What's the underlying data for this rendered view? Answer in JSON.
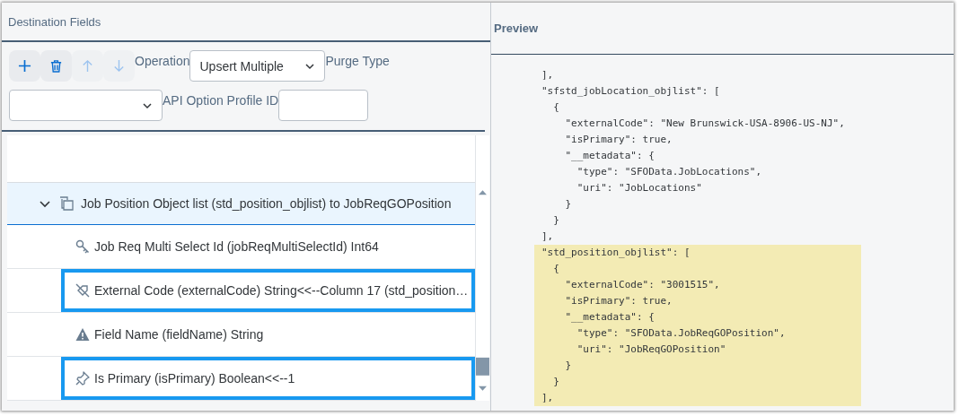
{
  "destination": {
    "title": "Destination Fields",
    "toolbar": [
      {
        "kind": "add",
        "disabled": false
      },
      {
        "kind": "delete",
        "disabled": false
      },
      {
        "kind": "up",
        "disabled": true
      },
      {
        "kind": "down",
        "disabled": true
      }
    ],
    "fields": [
      {
        "label": "Operation",
        "kind": "select",
        "value": "Upsert Multiple"
      },
      {
        "label": "Purge Type",
        "kind": "select"
      },
      {
        "label": "API Option Profile ID",
        "kind": "text"
      }
    ],
    "group": {
      "label": "Job Position Object list (std_position_objlist) to JobReqGOPosition",
      "expanded": true
    },
    "rows": [
      {
        "kind": "key",
        "label": "Job Req Multi Select Id (jobReqMultiSelectId) Int64",
        "selected": false
      },
      {
        "kind": "tag",
        "label": "External Code (externalCode) String<<--Column 17 (std_position…",
        "selected": true
      },
      {
        "kind": "warning",
        "label": "Field Name (fieldName) String",
        "selected": false
      },
      {
        "kind": "pin",
        "label": "Is Primary (isPrimary) Boolean<<--1",
        "selected": true
      }
    ]
  },
  "preview": {
    "title": "Preview",
    "lines": [
      {
        "text": "],",
        "highlighted": false
      },
      {
        "text": "\"sfstd_jobLocation_objlist\": [",
        "highlighted": false
      },
      {
        "text": "  {",
        "highlighted": false
      },
      {
        "text": "    \"externalCode\": \"New Brunswick-USA-8906-US-NJ\",",
        "highlighted": false
      },
      {
        "text": "    \"isPrimary\": true,",
        "highlighted": false
      },
      {
        "text": "    \"__metadata\": {",
        "highlighted": false
      },
      {
        "text": "      \"type\": \"SFOData.JobLocations\",",
        "highlighted": false
      },
      {
        "text": "      \"uri\": \"JobLocations\"",
        "highlighted": false
      },
      {
        "text": "    }",
        "highlighted": false
      },
      {
        "text": "  }",
        "highlighted": false
      },
      {
        "text": "],",
        "highlighted": false
      },
      {
        "text": "\"std_position_objlist\": [",
        "highlighted": true
      },
      {
        "text": "  {",
        "highlighted": true
      },
      {
        "text": "    \"externalCode\": \"3001515\",",
        "highlighted": true
      },
      {
        "text": "    \"isPrimary\": true,",
        "highlighted": true
      },
      {
        "text": "    \"__metadata\": {",
        "highlighted": true
      },
      {
        "text": "      \"type\": \"SFOData.JobReqGOPosition\",",
        "highlighted": true
      },
      {
        "text": "      \"uri\": \"JobReqGOPosition\"",
        "highlighted": true
      },
      {
        "text": "    }",
        "highlighted": true
      },
      {
        "text": "  }",
        "highlighted": true
      },
      {
        "text": "],",
        "highlighted": true
      }
    ]
  }
}
